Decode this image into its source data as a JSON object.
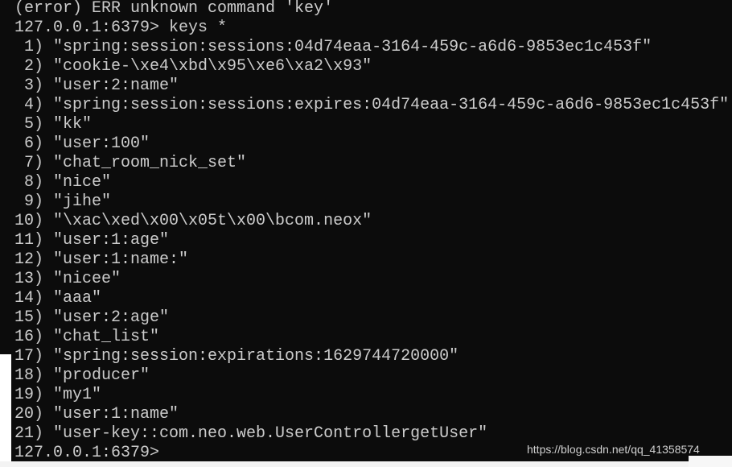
{
  "terminal": {
    "lines": [
      "(error) ERR unknown command 'key'",
      "127.0.0.1:6379> keys *",
      " 1) \"spring:session:sessions:04d74eaa-3164-459c-a6d6-9853ec1c453f\"",
      " 2) \"cookie-\\xe4\\xbd\\x95\\xe6\\xa2\\x93\"",
      " 3) \"user:2:name\"",
      " 4) \"spring:session:sessions:expires:04d74eaa-3164-459c-a6d6-9853ec1c453f\"",
      " 5) \"kk\"",
      " 6) \"user:100\"",
      " 7) \"chat_room_nick_set\"",
      " 8) \"nice\"",
      " 9) \"jihe\"",
      "10) \"\\xac\\xed\\x00\\x05t\\x00\\bcom.neox\"",
      "11) \"user:1:age\"",
      "12) \"user:1:name:\"",
      "13) \"nicee\"",
      "14) \"aaa\"",
      "15) \"user:2:age\"",
      "16) \"chat_list\"",
      "17) \"spring:session:expirations:1629744720000\"",
      "18) \"producer\"",
      "19) \"my1\"",
      "20) \"user:1:name\"",
      "21) \"user-key::com.neo.web.UserControllergetUser\"",
      "127.0.0.1:6379>"
    ]
  },
  "watermark": "https://blog.csdn.net/qq_41358574"
}
